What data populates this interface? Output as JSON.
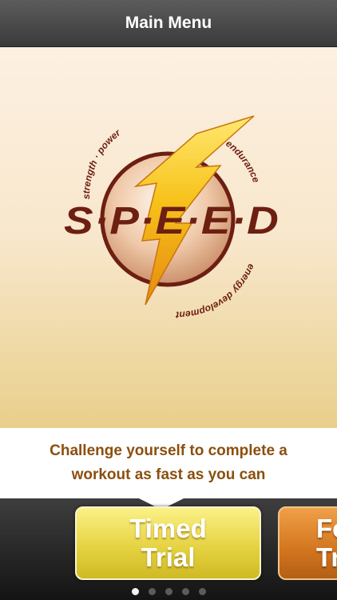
{
  "navbar": {
    "title": "Main Menu"
  },
  "logo": {
    "wordmark": "S·P·E·E·D",
    "arc_top": "strength · power",
    "arc_right": "endurance",
    "arc_bottom": "energy development",
    "colors": {
      "maroon": "#6d1f12",
      "bolt_yellow": "#f7c21a",
      "bolt_orange": "#e58a0f"
    }
  },
  "caption": {
    "text": "Challenge yourself to complete a workout as fast as you can"
  },
  "modes": [
    {
      "line1": "Timed",
      "line2": "Trial",
      "color": "#e6d343"
    },
    {
      "line1": "Fo",
      "line2": "Tr",
      "color": "#d2751e"
    }
  ],
  "pager": {
    "count": 5,
    "active_index": 0
  }
}
